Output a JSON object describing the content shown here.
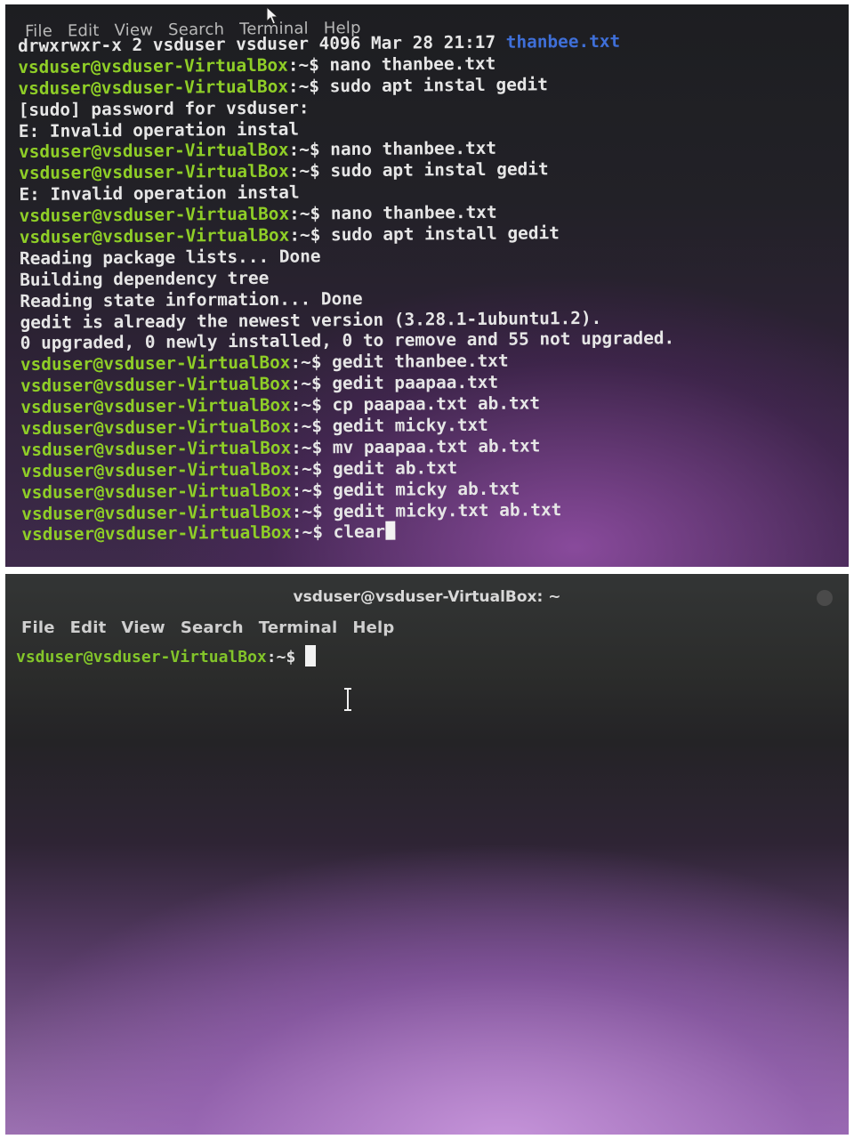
{
  "top_window": {
    "menu": [
      "File",
      "Edit",
      "View",
      "Search",
      "Terminal",
      "Help"
    ],
    "prompt_user": "vsduser@vsduser-VirtualBox",
    "prompt_path": ":~$",
    "lines": [
      {
        "text": "drwxrwxr-x 2 vsduser vsduser 4096 Mar 28 21:17 ",
        "link": "thanbee.txt"
      },
      {
        "cmd": " nano thanbee.txt"
      },
      {
        "cmd": " sudo apt instal gedit"
      },
      {
        "text": "[sudo] password for vsduser:"
      },
      {
        "text": "E: Invalid operation instal"
      },
      {
        "cmd": " nano thanbee.txt"
      },
      {
        "cmd": " sudo apt instal gedit"
      },
      {
        "text": "E: Invalid operation instal"
      },
      {
        "cmd": " nano thanbee.txt"
      },
      {
        "cmd": " sudo apt install gedit"
      },
      {
        "text": "Reading package lists... Done"
      },
      {
        "text": "Building dependency tree"
      },
      {
        "text": "Reading state information... Done"
      },
      {
        "text": "gedit is already the newest version (3.28.1-1ubuntu1.2)."
      },
      {
        "text": "0 upgraded, 0 newly installed, 0 to remove and 55 not upgraded."
      },
      {
        "cmd": " gedit thanbee.txt"
      },
      {
        "cmd": " gedit paapaa.txt"
      },
      {
        "cmd": " cp paapaa.txt ab.txt"
      },
      {
        "cmd": " gedit micky.txt"
      },
      {
        "cmd": " mv paapaa.txt ab.txt"
      },
      {
        "cmd": " gedit ab.txt"
      },
      {
        "cmd": " gedit micky ab.txt"
      },
      {
        "cmd": " gedit micky.txt ab.txt"
      },
      {
        "cmd": " clear",
        "cursor": true
      }
    ]
  },
  "bottom_window": {
    "title": "vsduser@vsduser-VirtualBox: ~",
    "menu": [
      "File",
      "Edit",
      "View",
      "Search",
      "Terminal",
      "Help"
    ],
    "prompt_user": "vsduser@vsduser-VirtualBox",
    "prompt_path": ":~$"
  },
  "colors": {
    "prompt_user": "#8fce27",
    "prompt_path": "#c9c9ff",
    "text": "#e6e6e6",
    "link": "#3f6fd8"
  },
  "icons": [
    "mouse-pointer-icon",
    "text-cursor-ibeam-icon"
  ]
}
